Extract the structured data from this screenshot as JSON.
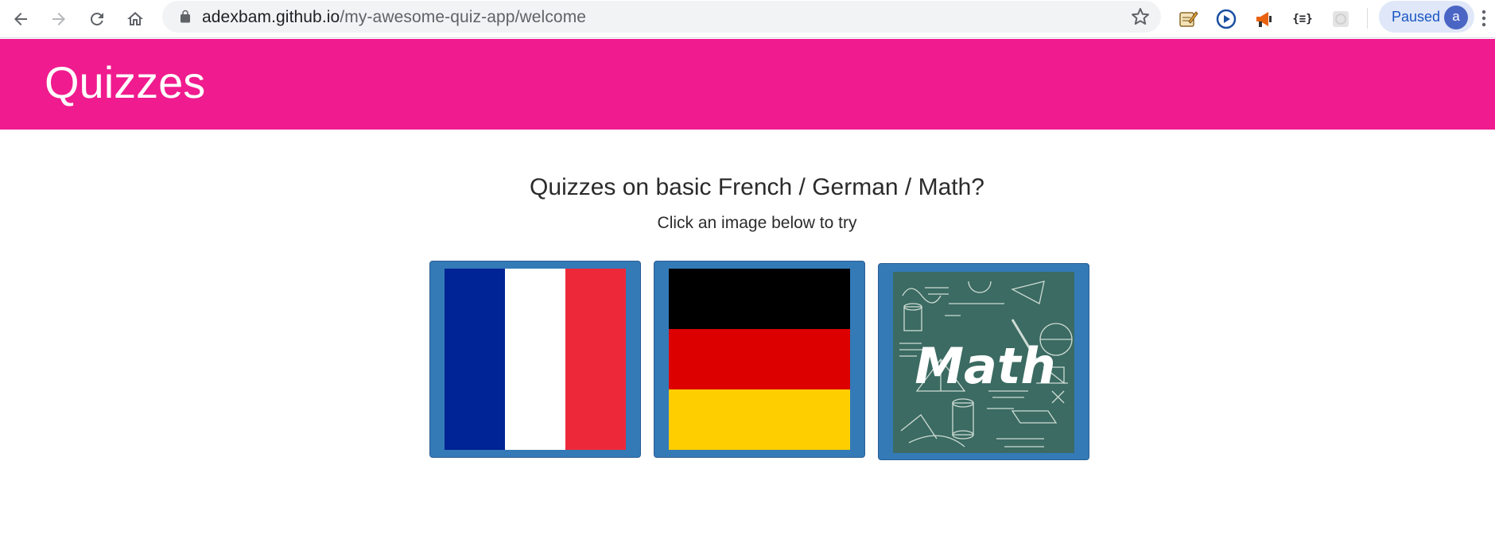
{
  "browser": {
    "url_host": "adexbam.github.io",
    "url_path": "/my-awesome-quiz-app/welcome",
    "profile_label": "Paused",
    "avatar_letter": "a",
    "extension_code_label": "{≡}"
  },
  "header": {
    "title": "Quizzes",
    "background": "#f01b8e"
  },
  "intro": {
    "headline": "Quizzes on basic French / German / Math?",
    "instruction": "Click an image below to try"
  },
  "quizzes": [
    {
      "name": "French",
      "flag_colors": [
        "#002395",
        "#ffffff",
        "#ed2939"
      ]
    },
    {
      "name": "German",
      "flag_colors": [
        "#000000",
        "#dd0000",
        "#ffce00"
      ]
    },
    {
      "name": "Math",
      "image_label": "Math",
      "chalkboard_color": "#3b6b62"
    }
  ],
  "colors": {
    "card_background": "#337ab7"
  }
}
